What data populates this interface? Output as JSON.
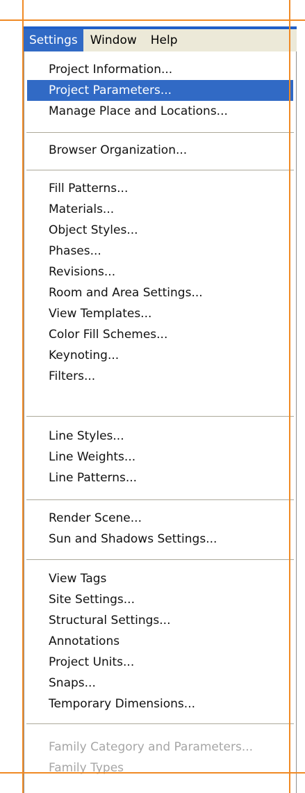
{
  "menubar": {
    "items": [
      {
        "label": "Settings",
        "active": true
      },
      {
        "label": "Window",
        "active": false
      },
      {
        "label": "Help",
        "active": false
      }
    ]
  },
  "settings_menu": {
    "items": [
      {
        "label": "Project Information..."
      },
      {
        "label": "Project Parameters...",
        "selected": true
      },
      {
        "label": "Manage Place and Locations..."
      },
      {
        "label": "Browser Organization..."
      },
      {
        "label": "Fill Patterns..."
      },
      {
        "label": "Materials..."
      },
      {
        "label": "Object Styles..."
      },
      {
        "label": "Phases..."
      },
      {
        "label": "Revisions..."
      },
      {
        "label": "Room and Area Settings..."
      },
      {
        "label": "View Templates..."
      },
      {
        "label": "Color Fill Schemes..."
      },
      {
        "label": "Keynoting..."
      },
      {
        "label": "Filters..."
      },
      {
        "label": "Line Styles..."
      },
      {
        "label": "Line Weights..."
      },
      {
        "label": "Line Patterns..."
      },
      {
        "label": "Render Scene..."
      },
      {
        "label": "Sun and Shadows Settings..."
      },
      {
        "label": "View Tags"
      },
      {
        "label": "Site Settings..."
      },
      {
        "label": "Structural Settings..."
      },
      {
        "label": "Annotations"
      },
      {
        "label": "Project Units..."
      },
      {
        "label": "Snaps..."
      },
      {
        "label": "Temporary Dimensions..."
      },
      {
        "label": "Family Category and Parameters...",
        "disabled": true
      },
      {
        "label": "Family Types",
        "disabled": true
      }
    ]
  },
  "colors": {
    "accent": "#316ac5",
    "crop_marks": "#f08a24",
    "disabled_text": "#a6a6a6"
  }
}
